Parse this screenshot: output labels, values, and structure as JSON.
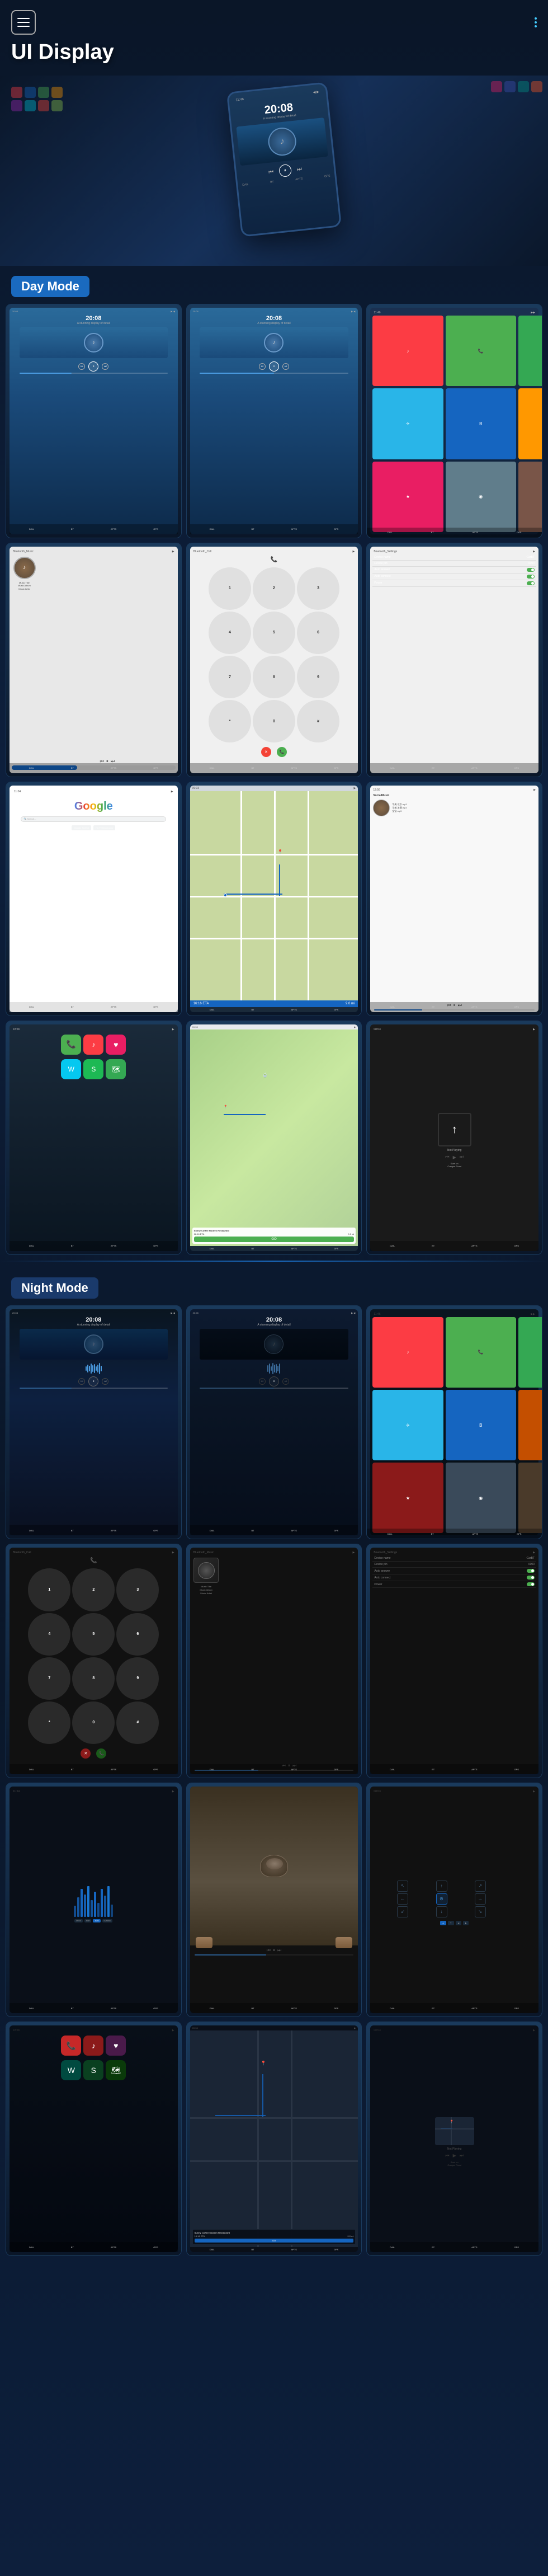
{
  "page": {
    "title": "UI Display",
    "hamburger_label": "menu",
    "dots_label": "more"
  },
  "hero": {
    "time": "20:08",
    "subtitle": "A stunning display of detail"
  },
  "day_mode": {
    "label": "Day Mode",
    "screens": [
      {
        "type": "music_player",
        "time": "20:08",
        "subtitle": "A stunning display of detail",
        "has_landscape": true,
        "theme": "light"
      },
      {
        "type": "music_player",
        "time": "20:08",
        "subtitle": "A stunning display of detail",
        "has_landscape": true,
        "theme": "light"
      },
      {
        "type": "app_grid",
        "theme": "light"
      },
      {
        "type": "music_detail",
        "title": "Music Title",
        "album": "Music Album",
        "artist": "Music Artist",
        "theme": "light"
      },
      {
        "type": "phone_keypad",
        "theme": "light"
      },
      {
        "type": "settings",
        "title": "Bluetooth_Settings",
        "device_name": "CarBT",
        "device_pin": "0000",
        "theme": "light"
      },
      {
        "type": "google",
        "theme": "white"
      },
      {
        "type": "navigation_map",
        "theme": "day"
      },
      {
        "type": "social_music",
        "theme": "light"
      },
      {
        "type": "carplay_home",
        "theme": "day"
      },
      {
        "type": "restaurant_nav",
        "name": "Sunny Coffee Modern Restaurant",
        "eta": "16:16 ETA",
        "distance": "9.0 mi",
        "theme": "day"
      },
      {
        "type": "not_playing",
        "road": "Congue Road",
        "theme": "dark"
      }
    ]
  },
  "night_mode": {
    "label": "Night Mode",
    "screens": [
      {
        "type": "music_player",
        "time": "20:08",
        "subtitle": "A stunning display of detail",
        "theme": "night"
      },
      {
        "type": "music_player",
        "time": "20:08",
        "subtitle": "A stunning display of detail",
        "theme": "night"
      },
      {
        "type": "app_grid",
        "theme": "night"
      },
      {
        "type": "phone_keypad",
        "title": "Bluetooth_Call",
        "theme": "night"
      },
      {
        "type": "music_detail",
        "title": "Music Title",
        "album": "Music Album",
        "artist": "Music Artist",
        "theme": "night"
      },
      {
        "type": "settings",
        "title": "Bluetooth_Settings",
        "device_name": "CarBT",
        "device_pin": "0000",
        "theme": "night"
      },
      {
        "type": "wave_viz",
        "theme": "night"
      },
      {
        "type": "food_photo",
        "theme": "night"
      },
      {
        "type": "navigation_turn",
        "theme": "night"
      },
      {
        "type": "carplay_home",
        "theme": "night"
      },
      {
        "type": "restaurant_nav",
        "name": "Sunny Coffee Modern Restaurant",
        "eta": "16:16 ETA",
        "distance": "9.0 mi",
        "theme": "night"
      },
      {
        "type": "not_playing",
        "road": "Congue Road",
        "theme": "night"
      }
    ]
  },
  "bottom_bar": {
    "items": [
      "DAIL",
      "BT",
      "APTS",
      "GPS"
    ]
  }
}
